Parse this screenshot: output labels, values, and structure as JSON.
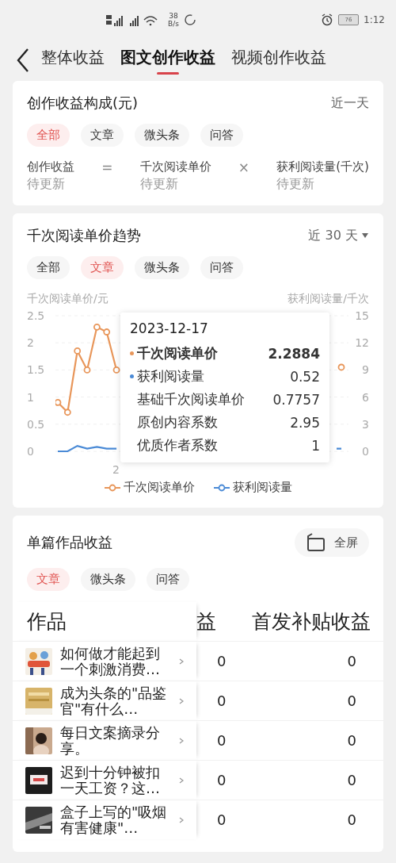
{
  "status_bar": {
    "speed_value": "38",
    "speed_unit": "B/s",
    "battery": "76",
    "time": "1:12"
  },
  "header": {
    "tabs": [
      {
        "label": "整体收益",
        "selected": false
      },
      {
        "label": "图文创作收益",
        "selected": true
      },
      {
        "label": "视频创作收益",
        "selected": false
      }
    ]
  },
  "composition_card": {
    "title": "创作收益构成(元)",
    "period": "近一天",
    "chips": [
      {
        "label": "全部",
        "selected": true
      },
      {
        "label": "文章",
        "selected": false
      },
      {
        "label": "微头条",
        "selected": false
      },
      {
        "label": "问答",
        "selected": false
      }
    ],
    "formula": [
      {
        "kind": "term",
        "label": "创作收益",
        "value": "待更新"
      },
      {
        "kind": "operator",
        "label": "="
      },
      {
        "kind": "term",
        "label": "千次阅读单价",
        "value": "待更新"
      },
      {
        "kind": "operator",
        "label": "×"
      },
      {
        "kind": "term",
        "label": "获利阅读量(千次)",
        "value": "待更新"
      }
    ]
  },
  "trend_card": {
    "title": "千次阅读单价趋势",
    "period": "近 30 天",
    "chips": [
      {
        "label": "全部",
        "selected": false
      },
      {
        "label": "文章",
        "selected": true
      },
      {
        "label": "微头条",
        "selected": false
      },
      {
        "label": "问答",
        "selected": false
      }
    ],
    "x_label_fragment": "2",
    "chart_data": {
      "type": "line",
      "ylabel": "千次阅读单价/元",
      "y2label": "获利阅读量/千次",
      "ylim": [
        0,
        2.5
      ],
      "y2lim": [
        0,
        15
      ],
      "yticks": [
        2.5,
        2,
        1.5,
        1,
        0.5,
        0
      ],
      "y2ticks": [
        15,
        12,
        9,
        6,
        3,
        0
      ],
      "grid": true,
      "legend": true,
      "series": [
        {
          "name": "千次阅读单价",
          "color": "#e8965a",
          "marker": "circle",
          "values": [
            0.9,
            0.72,
            1.85,
            1.5,
            2.29,
            2.2,
            1.5,
            null,
            null,
            null,
            null,
            null,
            null,
            null,
            null,
            null,
            null,
            null,
            null,
            null,
            null,
            null,
            null,
            null,
            null,
            null,
            null,
            null,
            null,
            1.55
          ]
        },
        {
          "name": "获利阅读量",
          "color": "#4a8ad6",
          "axis": "y2",
          "marker": "none",
          "values": [
            0,
            0,
            0.6,
            0.3,
            0.5,
            0.3,
            0.3,
            null,
            null,
            null,
            null,
            null,
            null,
            null,
            null,
            null,
            null,
            null,
            null,
            null,
            null,
            null,
            null,
            null,
            null,
            null,
            null,
            null,
            null,
            0.3
          ]
        }
      ]
    },
    "tooltip": {
      "date": "2023-12-17",
      "rows": [
        {
          "label": "千次阅读单价",
          "value": "2.2884",
          "color": "#e8965a",
          "emphasized": true
        },
        {
          "label": "获利阅读量",
          "value": "0.52",
          "color": "#4a8ad6",
          "emphasized": false
        },
        {
          "label": "基础千次阅读单价",
          "value": "0.7757",
          "emphasized": false
        },
        {
          "label": "原创内容系数",
          "value": "2.95",
          "emphasized": false
        },
        {
          "label": "优质作者系数",
          "value": "1",
          "emphasized": false
        }
      ]
    }
  },
  "works_card": {
    "title": "单篇作品收益",
    "fullscreen_label": "全屏",
    "chips": [
      {
        "label": "文章",
        "selected": true
      },
      {
        "label": "微头条",
        "selected": false
      },
      {
        "label": "问答",
        "selected": false
      }
    ],
    "table": {
      "columns": [
        "作品",
        "益",
        "首发补贴收益"
      ],
      "rows": [
        {
          "title": "如何做才能起到一个刺激消费…",
          "column_2": "0",
          "column_3": "0"
        },
        {
          "title": "成为头条的\"品鉴官\"有什么…",
          "column_2": "0",
          "column_3": "0"
        },
        {
          "title": "每日文案摘录分享。",
          "column_2": "0",
          "column_3": "0"
        },
        {
          "title": "迟到十分钟被扣一天工资？这…",
          "column_2": "0",
          "column_3": "0"
        },
        {
          "title": "盒子上写的\"吸烟有害健康\"…",
          "column_2": "0",
          "column_3": "0"
        }
      ]
    }
  }
}
